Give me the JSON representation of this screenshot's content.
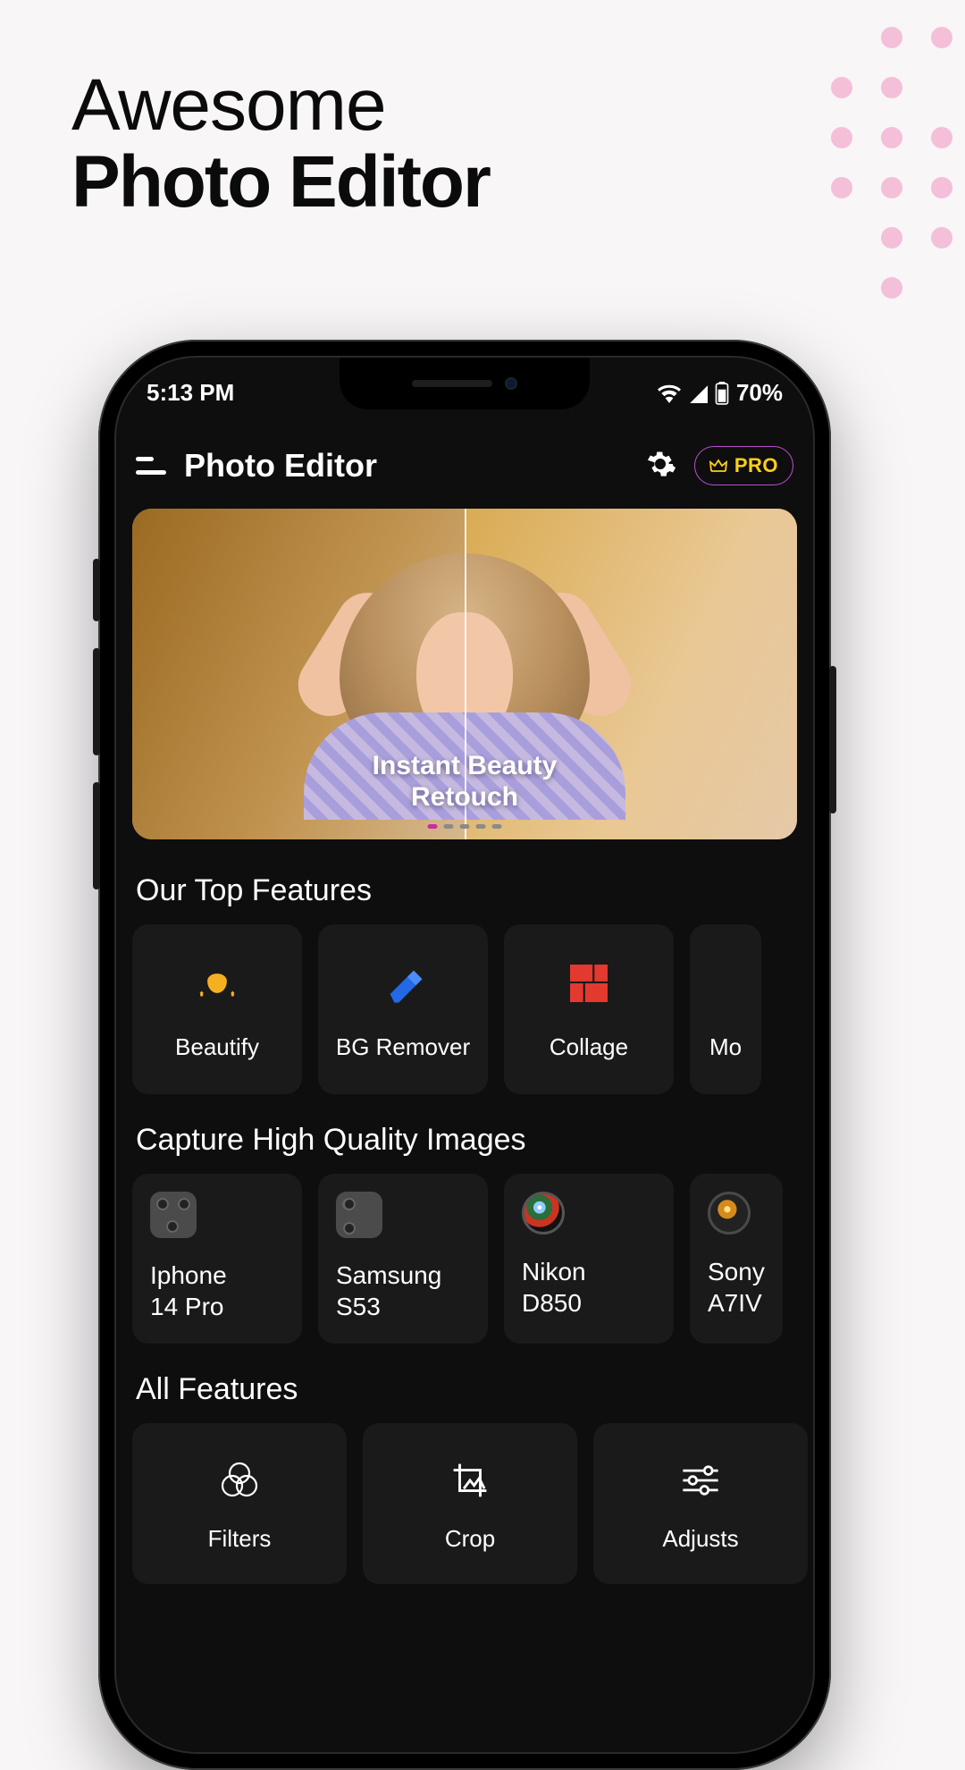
{
  "headline": {
    "line1": "Awesome",
    "line2": "Photo Editor"
  },
  "status": {
    "time": "5:13 PM",
    "battery": "70%"
  },
  "header": {
    "title": "Photo Editor",
    "pro_label": "PRO"
  },
  "hero": {
    "title_line1": "Instant Beauty",
    "title_line2": "Retouch"
  },
  "sections": {
    "top_features": "Our Top Features",
    "capture": "Capture High Quality Images",
    "all_features": "All Features"
  },
  "features": [
    {
      "label": "Beautify"
    },
    {
      "label": "BG Remover"
    },
    {
      "label": "Collage"
    },
    {
      "label": "Mo"
    }
  ],
  "cameras": [
    {
      "name": "Iphone",
      "model": "14 Pro"
    },
    {
      "name": "Samsung",
      "model": "S53"
    },
    {
      "name": "Nikon",
      "model": "D850"
    },
    {
      "name": "Sony",
      "model": "A7IV"
    }
  ],
  "all_features": [
    {
      "label": "Filters"
    },
    {
      "label": "Crop"
    },
    {
      "label": "Adjusts"
    }
  ]
}
